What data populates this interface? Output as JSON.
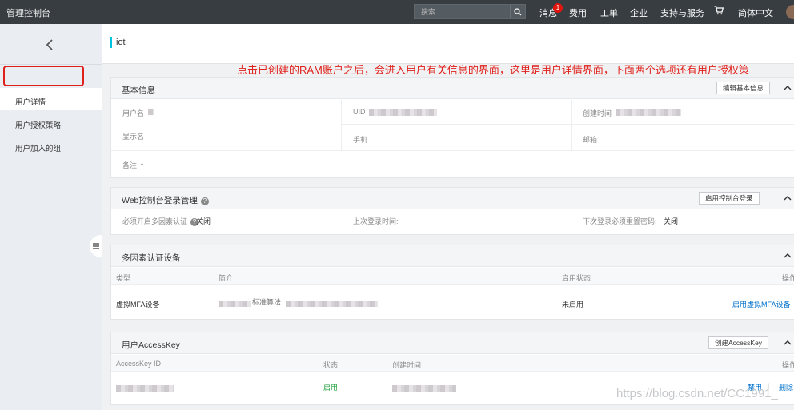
{
  "topbar": {
    "brand": "管理控制台",
    "search_placeholder": "搜索",
    "messages": "消息",
    "message_count": "1",
    "billing": "费用",
    "tickets": "工单",
    "enterprise": "企业",
    "support": "支持与服务",
    "language": "简体中文"
  },
  "sidebar": {
    "items": [
      {
        "label": "用户详情"
      },
      {
        "label": "用户授权策略"
      },
      {
        "label": "用户加入的组"
      }
    ]
  },
  "page": {
    "title": "iot"
  },
  "annotation": "点击已创建的RAM账户之后，会进入用户有关信息的界面，这里是用户详情界面，下面两个选项还有用户授权策略和用户加入的组。",
  "basic_info": {
    "title": "基本信息",
    "edit_button": "编辑基本信息",
    "username_label": "用户名",
    "uid_label": "UID",
    "created_label": "创建时间",
    "display_name_label": "显示名",
    "phone_label": "手机",
    "email_label": "邮箱",
    "notes_label": "备注",
    "notes_value": "-"
  },
  "web_console": {
    "title": "Web控制台登录管理",
    "enable_button": "启用控制台登录",
    "mfa_required_label": "必须开启多因素认证",
    "mfa_required_value": "关闭",
    "last_login_label": "上次登录时间:",
    "reset_pwd_label": "下次登录必须重置密码:",
    "reset_pwd_value": "关闭"
  },
  "mfa": {
    "title": "多因素认证设备",
    "columns": [
      "类型",
      "简介",
      "启用状态",
      "操作"
    ],
    "row": {
      "type": "虚拟MFA设备",
      "desc": "标准算法",
      "status": "未启用",
      "action": "启用虚拟MFA设备"
    }
  },
  "accesskey": {
    "title": "用户AccessKey",
    "create_button": "创建AccessKey",
    "columns": [
      "AccessKey ID",
      "状态",
      "创建时间",
      "操作"
    ],
    "row": {
      "status": "启用",
      "disable": "禁用",
      "delete": "删除"
    }
  },
  "watermark": "https://blog.csdn.net/CC1991_",
  "colors": {
    "topbar": "#373d41",
    "link": "#0070cc",
    "annotation": "#e0201b",
    "active_status": "#1e9e39"
  }
}
